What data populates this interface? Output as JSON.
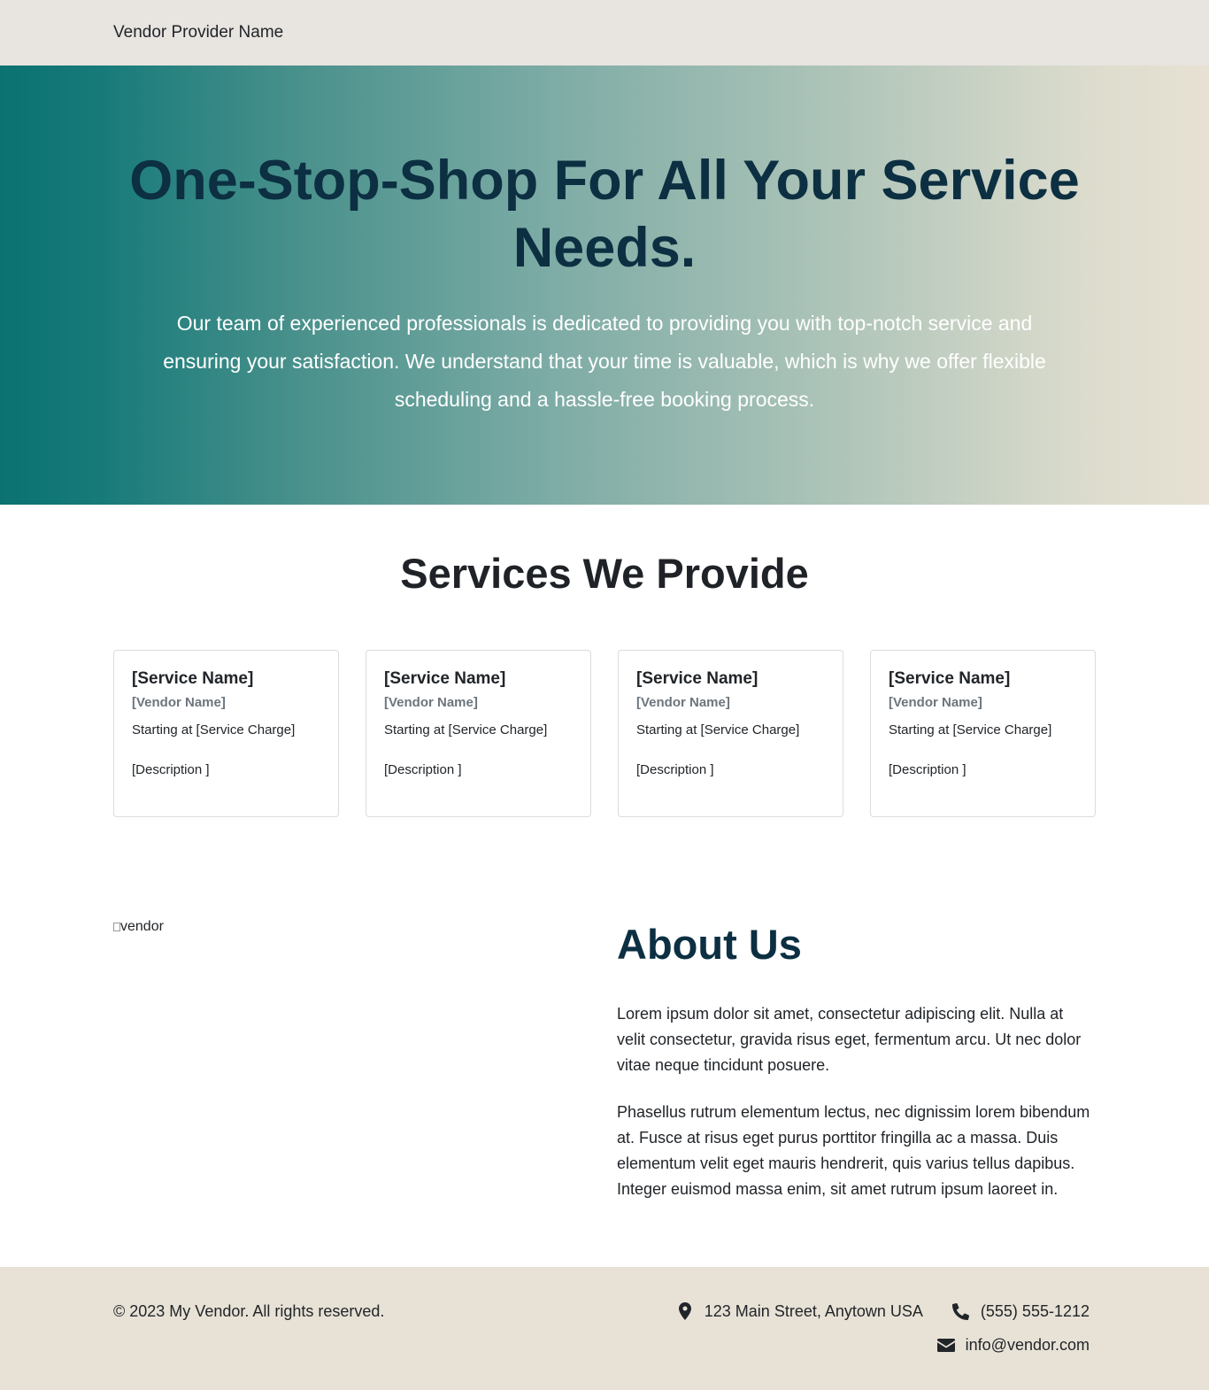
{
  "navbar": {
    "brand": "Vendor Provider Name"
  },
  "hero": {
    "title": "One-Stop-Shop For All Your Service Needs.",
    "text": "Our team of experienced professionals is dedicated to providing you with top-notch service and ensuring your satisfaction. We understand that your time is valuable, which is why we offer flexible scheduling and a hassle-free booking process."
  },
  "services": {
    "heading": "Services We Provide",
    "cards": [
      {
        "title": "[Service Name]",
        "vendor": "[Vendor Name]",
        "charge": "Starting at [Service Charge]",
        "description": "[Description ]"
      },
      {
        "title": "[Service Name]",
        "vendor": "[Vendor Name]",
        "charge": "Starting at [Service Charge]",
        "description": "[Description ]"
      },
      {
        "title": "[Service Name]",
        "vendor": "[Vendor Name]",
        "charge": "Starting at [Service Charge]",
        "description": "[Description ]"
      },
      {
        "title": "[Service Name]",
        "vendor": "[Vendor Name]",
        "charge": "Starting at [Service Charge]",
        "description": "[Description ]"
      }
    ]
  },
  "about": {
    "image_alt": "vendor",
    "heading": "About Us",
    "paragraph1": "Lorem ipsum dolor sit amet, consectetur adipiscing elit. Nulla at velit consectetur, gravida risus eget, fermentum arcu. Ut nec dolor vitae neque tincidunt posuere.",
    "paragraph2": "Phasellus rutrum elementum lectus, nec dignissim lorem bibendum at. Fusce at risus eget purus porttitor fringilla ac a massa. Duis elementum velit eget mauris hendrerit, quis varius tellus dapibus. Integer euismod massa enim, sit amet rutrum ipsum laoreet in."
  },
  "footer": {
    "copyright": "© 2023 My Vendor. All rights reserved.",
    "address": "123 Main Street, Anytown USA",
    "phone": "(555) 555-1212",
    "email": "info@vendor.com",
    "icons": {
      "address": "map-marker-icon",
      "phone": "phone-icon",
      "email": "envelope-icon"
    }
  }
}
